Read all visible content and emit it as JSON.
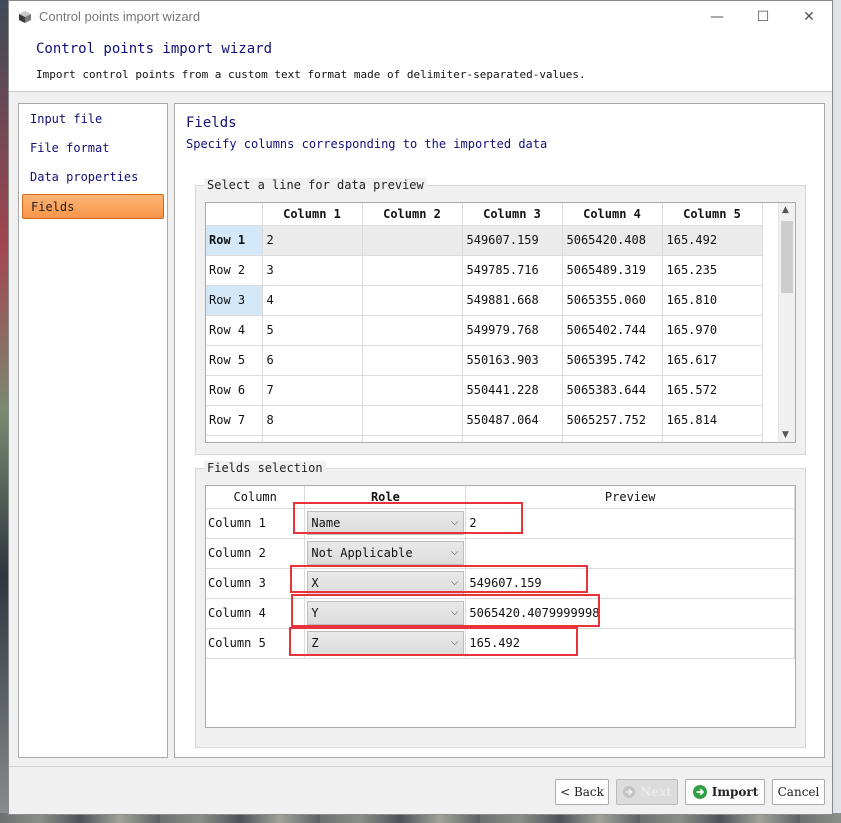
{
  "window": {
    "title": "Control points import wizard",
    "minimize_glyph": "—",
    "maximize_glyph": "☐",
    "close_glyph": "✕"
  },
  "header": {
    "title": "Control points import wizard",
    "subtitle": "Import control points from a custom text format made of delimiter-separated-values."
  },
  "sidebar": {
    "items": [
      {
        "label": "Input file",
        "active": false
      },
      {
        "label": "File format",
        "active": false
      },
      {
        "label": "Data properties",
        "active": false
      },
      {
        "label": "Fields",
        "active": true
      }
    ]
  },
  "content": {
    "title": "Fields",
    "subtitle": "Specify columns corresponding to the imported data"
  },
  "preview": {
    "group_label": "Select a line for data preview",
    "columns": [
      "Column 1",
      "Column 2",
      "Column 3",
      "Column 4",
      "Column 5"
    ],
    "rows": [
      {
        "label": "Row 1",
        "cells": [
          "2",
          "",
          "549607.159",
          "5065420.408",
          "165.492"
        ]
      },
      {
        "label": "Row 2",
        "cells": [
          "3",
          "",
          "549785.716",
          "5065489.319",
          "165.235"
        ]
      },
      {
        "label": "Row 3",
        "cells": [
          "4",
          "",
          "549881.668",
          "5065355.060",
          "165.810"
        ]
      },
      {
        "label": "Row 4",
        "cells": [
          "5",
          "",
          "549979.768",
          "5065402.744",
          "165.970"
        ]
      },
      {
        "label": "Row 5",
        "cells": [
          "6",
          "",
          "550163.903",
          "5065395.742",
          "165.617"
        ]
      },
      {
        "label": "Row 6",
        "cells": [
          "7",
          "",
          "550441.228",
          "5065383.644",
          "165.572"
        ]
      },
      {
        "label": "Row 7",
        "cells": [
          "8",
          "",
          "550487.064",
          "5065257.752",
          "165.814"
        ]
      }
    ],
    "scroll_up": "▲",
    "scroll_down": "▼"
  },
  "fields": {
    "group_label": "Fields selection",
    "headers": {
      "column": "Column",
      "role": "Role",
      "preview": "Preview"
    },
    "rows": [
      {
        "column": "Column 1",
        "role": "Name",
        "preview": "2"
      },
      {
        "column": "Column 2",
        "role": "Not Applicable",
        "preview": ""
      },
      {
        "column": "Column 3",
        "role": "X",
        "preview": "549607.159"
      },
      {
        "column": "Column 4",
        "role": "Y",
        "preview": "5065420.4079999998"
      },
      {
        "column": "Column 5",
        "role": "Z",
        "preview": "165.492"
      }
    ],
    "chevron": "⌵"
  },
  "buttons": {
    "back": "< Back",
    "next": "Next",
    "import": "Import",
    "cancel": "Cancel"
  },
  "colors": {
    "accent_title": "#10107a",
    "active_item": "#f8954a",
    "annotation_red": "#e8333a"
  }
}
